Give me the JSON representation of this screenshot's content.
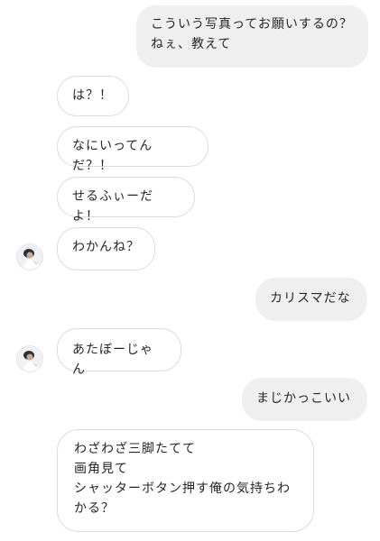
{
  "messages": [
    {
      "from": "me",
      "text": "こういう写真ってお願いするの？\nねぇ、教えて"
    },
    {
      "from": "them",
      "text": "は？！"
    },
    {
      "from": "them",
      "text": "なにいってんだ？！"
    },
    {
      "from": "them",
      "text": "せるふぃーだよ！"
    },
    {
      "from": "them",
      "text": "わかんね？"
    },
    {
      "from": "me",
      "text": "カリスマだな"
    },
    {
      "from": "them",
      "text": "あたぼーじゃん"
    },
    {
      "from": "me",
      "text": "まじかっこいい"
    },
    {
      "from": "them",
      "text": "わざわざ三脚たてて\n画角見て\nシャッターボタン押す俺の気持ちわかる？"
    }
  ]
}
